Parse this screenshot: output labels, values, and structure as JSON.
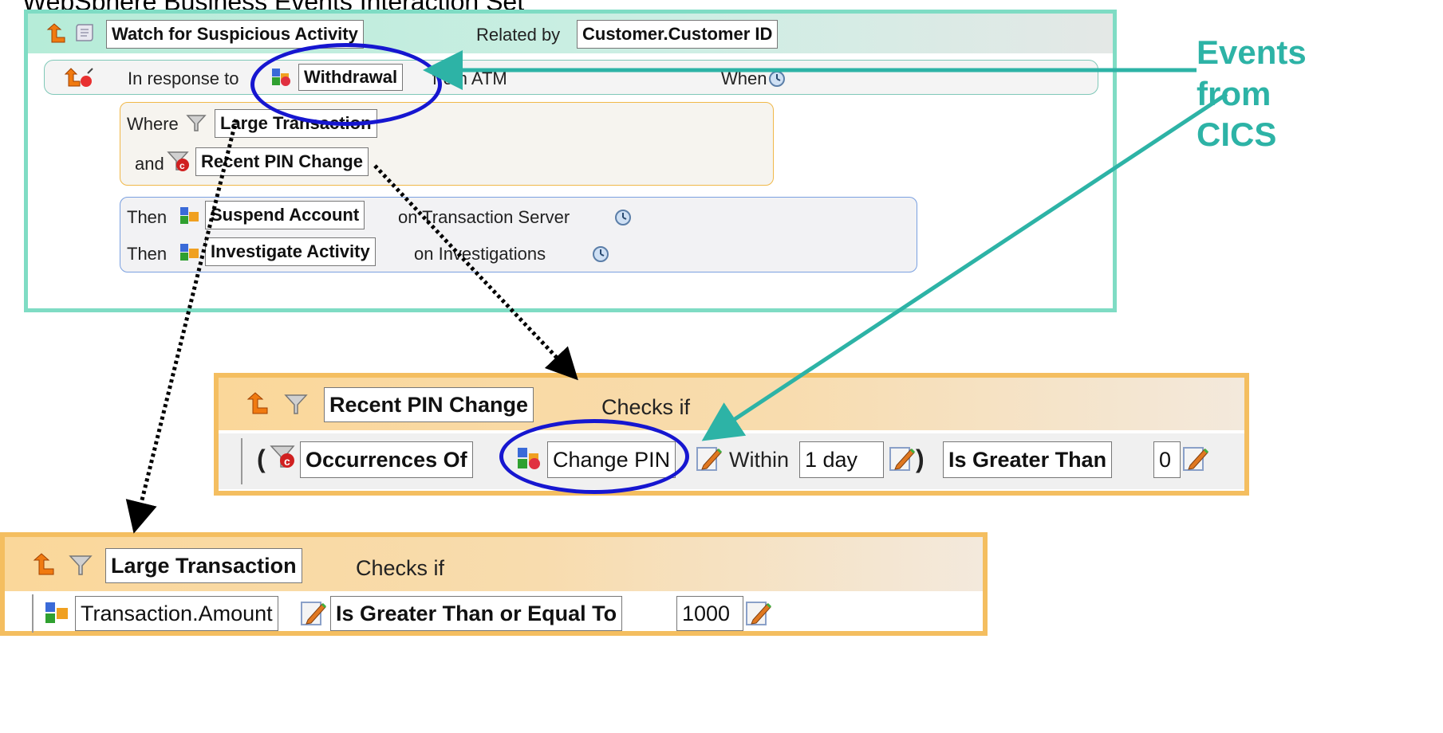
{
  "page_title": "WebSphere Business Events Interaction Set",
  "interaction_set": {
    "name": "Watch for Suspicious Activity",
    "related_by_label": "Related by",
    "related_by_value": "Customer.Customer ID",
    "in_response_label": "In response to",
    "event": "Withdrawal",
    "from_label": "from ATM",
    "when_label": "When",
    "where_label": "Where",
    "and_label": "and",
    "filter1": "Large Transaction",
    "filter2": "Recent PIN Change",
    "then_label": "Then",
    "action1": "Suspend Account",
    "action1_target": "on Transaction Server",
    "action2": "Investigate Activity",
    "action2_target": "on Investigations"
  },
  "callout": {
    "line1": "Events",
    "line2": "from",
    "line3": "CICS",
    "color": "#2db3a6"
  },
  "recent_pin_filter": {
    "name": "Recent PIN Change",
    "checks_if": "Checks if",
    "open_paren": "(",
    "function": "Occurrences Of",
    "event": "Change PIN",
    "within_label": "Within",
    "within_value": "1 day",
    "close_paren": ")",
    "operator": "Is Greater Than",
    "value": "0"
  },
  "large_txn_filter": {
    "name": "Large Transaction",
    "checks_if": "Checks if",
    "field": "Transaction.Amount",
    "operator": "Is Greater Than or Equal To",
    "value": "1000"
  },
  "colors": {
    "interaction_border": "#7fdcc4",
    "filter_border": "#f4be60",
    "highlight_ellipse": "#1616d0",
    "arrow_teal": "#2db3a6"
  }
}
